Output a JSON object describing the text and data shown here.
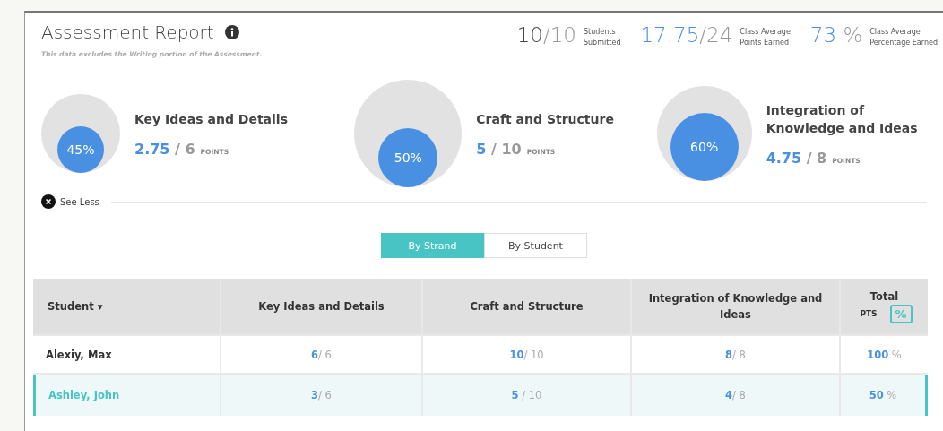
{
  "header": {
    "title": "Assessment Report",
    "note": "This data excludes the Writing portion of the Assessment."
  },
  "stats": [
    {
      "value": "10",
      "total": "/10",
      "label_1": "Students",
      "label_2": "Submitted",
      "kind": "dark"
    },
    {
      "value": "17.75",
      "total": "/24",
      "label_1": "Class Average",
      "label_2": "Points Earned",
      "kind": "blue"
    },
    {
      "value": "73",
      "total": " %",
      "label_1": "Class Average",
      "label_2": "Percentage Earned",
      "kind": "blue"
    }
  ],
  "strands": [
    {
      "title": "Key Ideas and Details",
      "percent": "45%",
      "earned": "2.75",
      "total": "/ 6",
      "unit": "POINTS"
    },
    {
      "title": "Craft and Structure",
      "percent": "50%",
      "earned": "5",
      "total": "/ 10",
      "unit": "POINTS"
    },
    {
      "title": "Integration of Knowledge and Ideas",
      "percent": "60%",
      "earned": "4.75",
      "total": "/ 8",
      "unit": "POINTS"
    }
  ],
  "toggle": {
    "label": "See Less"
  },
  "view_tabs": [
    {
      "label": "By Strand",
      "selected": true
    },
    {
      "label": "By Student",
      "selected": false
    }
  ],
  "table": {
    "columns": [
      {
        "label": "Student",
        "caret": "▾"
      },
      {
        "label": "Key Ideas and Details"
      },
      {
        "label": "Craft and Structure"
      },
      {
        "label": "Integration of Knowledge and Ideas"
      }
    ],
    "total": {
      "label": "Total",
      "units": [
        {
          "label": "PTS",
          "selected": false
        },
        {
          "label": "%",
          "selected": true
        }
      ]
    },
    "rows": [
      {
        "name": "Alexiy, Max",
        "selected": false,
        "scores": [
          {
            "earned": "6",
            "total": "/ 6"
          },
          {
            "earned": "10",
            "total": "/ 10"
          },
          {
            "earned": "8",
            "total": "/ 8"
          }
        ],
        "total": "100",
        "unit": "%"
      },
      {
        "name": "Ashley, John",
        "selected": true,
        "scores": [
          {
            "earned": "3",
            "total": "/ 6"
          },
          {
            "earned": "5",
            "total": " / 10"
          },
          {
            "earned": "4",
            "total": "/ 8"
          }
        ],
        "total": "50",
        "unit": "%"
      }
    ]
  }
}
